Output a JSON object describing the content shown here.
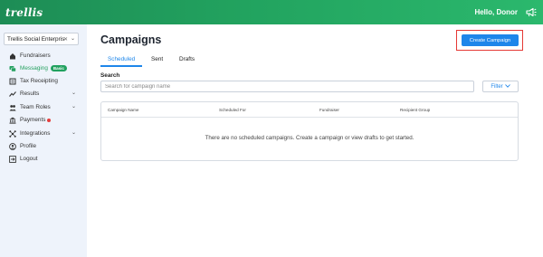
{
  "header": {
    "logo": "trellis",
    "greeting": "Hello, Donor"
  },
  "sidebar": {
    "org_select": "Trellis Social Enterprise",
    "items": [
      {
        "label": "Fundraisers",
        "icon": "home-icon"
      },
      {
        "label": "Messaging",
        "icon": "messaging-icon",
        "badge": "Basic",
        "active": true
      },
      {
        "label": "Tax Receipting",
        "icon": "receipt-icon"
      },
      {
        "label": "Results",
        "icon": "chart-icon",
        "expandable": true
      },
      {
        "label": "Team Roles",
        "icon": "users-icon",
        "expandable": true
      },
      {
        "label": "Payments",
        "icon": "bank-icon",
        "alert": true
      },
      {
        "label": "Integrations",
        "icon": "integrations-icon",
        "expandable": true
      },
      {
        "label": "Profile",
        "icon": "profile-icon"
      },
      {
        "label": "Logout",
        "icon": "logout-icon"
      }
    ]
  },
  "main": {
    "title": "Campaigns",
    "create_button": "Create Campaign",
    "tabs": [
      {
        "label": "Scheduled",
        "active": true
      },
      {
        "label": "Sent"
      },
      {
        "label": "Drafts"
      }
    ],
    "search": {
      "label": "Search",
      "placeholder": "Search for campaign name"
    },
    "filter_button": "Filter",
    "table": {
      "columns": [
        "Campaign Name",
        "Scheduled For",
        "Fundraiser",
        "Recipient Group"
      ],
      "empty_message": "There are no scheduled campaigns. Create a campaign or view drafts to get started."
    }
  },
  "colors": {
    "brand_green": "#22a35f",
    "accent_blue": "#1e86ea",
    "highlight_red": "#e53935",
    "sidebar_bg": "#eef3fb"
  }
}
